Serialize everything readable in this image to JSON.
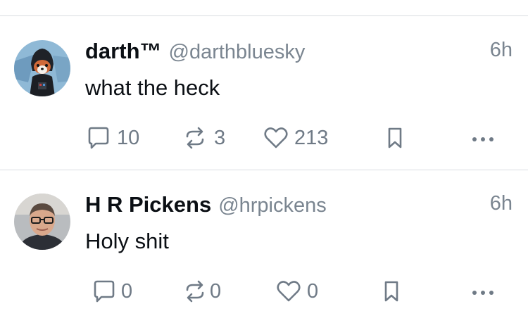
{
  "posts": [
    {
      "author": {
        "display_name": "darth™",
        "handle": "@darthbluesky",
        "avatar": "red-panda-darth-vader-avatar"
      },
      "timestamp": "6h",
      "text": "what the heck",
      "actions": {
        "reply_count": "10",
        "repost_count": "3",
        "like_count": "213"
      }
    },
    {
      "author": {
        "display_name": "H R Pickens",
        "handle": "@hrpickens",
        "avatar": "man-with-glasses-avatar"
      },
      "timestamp": "6h",
      "text": "Holy shit",
      "actions": {
        "reply_count": "0",
        "repost_count": "0",
        "like_count": "0"
      }
    }
  ],
  "icons": {
    "reply": "speech-bubble-icon",
    "repost": "repost-arrows-icon",
    "like": "heart-icon",
    "bookmark": "bookmark-icon",
    "more": "ellipsis-icon"
  },
  "colors": {
    "text": "#0b0f14",
    "muted": "#7a8590",
    "divider": "#d9dde1"
  }
}
